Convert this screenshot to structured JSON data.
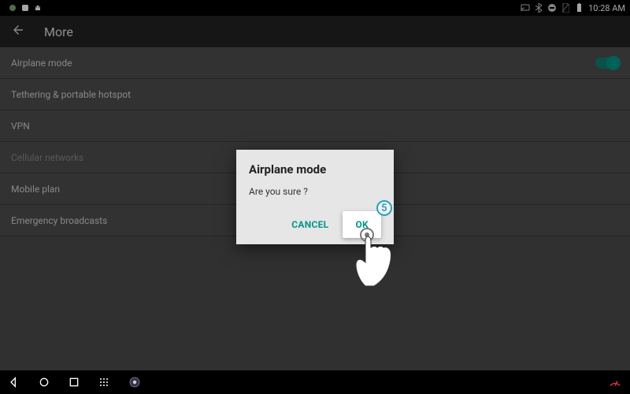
{
  "status": {
    "time": "10:28 AM"
  },
  "actionbar": {
    "title": "More"
  },
  "settings": {
    "items": [
      {
        "label": "Airplane mode",
        "toggle": true,
        "disabled": false
      },
      {
        "label": "Tethering & portable hotspot",
        "toggle": false,
        "disabled": false
      },
      {
        "label": "VPN",
        "toggle": false,
        "disabled": false
      },
      {
        "label": "Cellular networks",
        "toggle": false,
        "disabled": true
      },
      {
        "label": "Mobile plan",
        "toggle": false,
        "disabled": false
      },
      {
        "label": "Emergency broadcasts",
        "toggle": false,
        "disabled": false
      }
    ]
  },
  "dialog": {
    "title": "Airplane mode",
    "message": "Are you sure ?",
    "cancel": "CANCEL",
    "ok": "OK"
  },
  "tutorial": {
    "step": "5"
  }
}
